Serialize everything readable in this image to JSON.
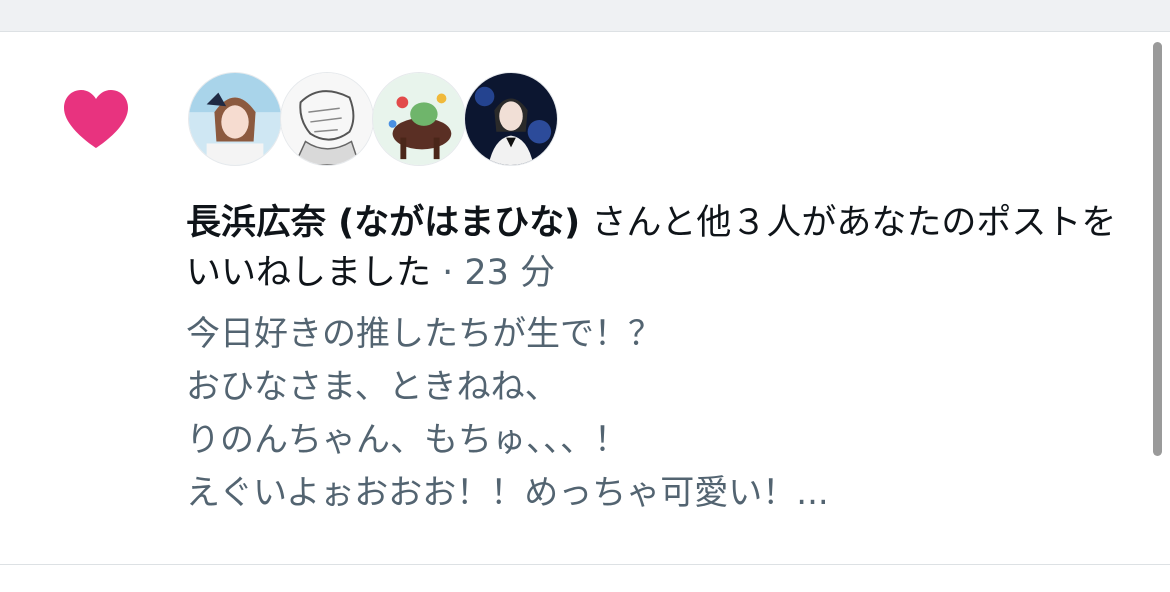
{
  "notification": {
    "type_icon": "heart-icon",
    "accent_color": "#e0245e",
    "avatars": [
      {
        "label": "avatar-1"
      },
      {
        "label": "avatar-2"
      },
      {
        "label": "avatar-3"
      },
      {
        "label": "avatar-4"
      }
    ],
    "user_name": "長浜広奈 (ながはまひな)",
    "action_text": " さんと他３人があなたのポストをいいねしました",
    "separator": " · ",
    "time": "23 分",
    "preview_lines": [
      "今日好きの推したちが生で！？",
      "おひなさま、ときねね、",
      "りのんちゃん、もちゅ、、、！",
      "えぐいよぉおおお！！めっちゃ可愛い！..."
    ]
  }
}
